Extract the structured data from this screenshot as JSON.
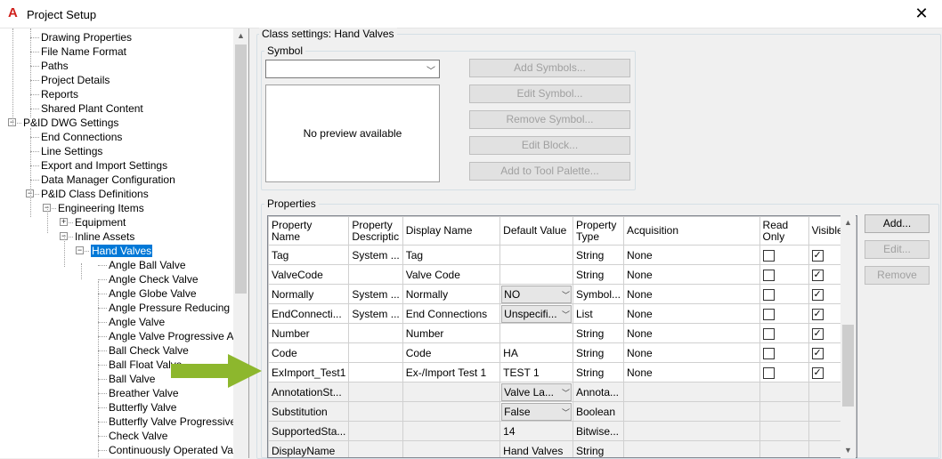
{
  "window": {
    "title": "Project Setup",
    "app_icon": "A",
    "close_glyph": "✕"
  },
  "tree": {
    "items": [
      "Drawing Properties",
      "File Name Format",
      "Paths",
      "Project Details",
      "Reports",
      "Shared Plant Content",
      "P&ID DWG Settings",
      "End Connections",
      "Line Settings",
      "Export and Import Settings",
      "Data Manager Configuration",
      "P&ID Class Definitions",
      "Engineering Items",
      "Equipment",
      "Inline Assets",
      "Hand Valves",
      "Angle Ball Valve",
      "Angle Check Valve",
      "Angle Globe Valve",
      "Angle Pressure Reducing Inje",
      "Angle Valve",
      "Angle Valve Progressive Adju",
      "Ball Check Valve",
      "Ball Float Valve",
      "Ball Valve",
      "Breather Valve",
      "Butterfly Valve",
      "Butterfly Valve Progressive Ad",
      "Check Valve",
      "Continuously Operated Valve"
    ]
  },
  "class_settings": {
    "title": "Class settings: Hand Valves",
    "symbol_group": "Symbol",
    "preview_text": "No preview available",
    "buttons": [
      "Add Symbols...",
      "Edit Symbol...",
      "Remove Symbol...",
      "Edit Block...",
      "Add to Tool Palette..."
    ]
  },
  "properties": {
    "group": "Properties",
    "columns": [
      "Property Name",
      "Property Description",
      "Display Name",
      "Default Value",
      "Property Type",
      "Acquisition",
      "Read Only",
      "Visible"
    ],
    "column_labels": [
      [
        "Property",
        "Name"
      ],
      [
        "Property",
        "Descriptic"
      ],
      [
        "Display Name"
      ],
      [
        "Default Value"
      ],
      [
        "Property",
        "Type"
      ],
      [
        "Acquisition"
      ],
      [
        "Read",
        "Only"
      ],
      [
        "Visible"
      ]
    ],
    "rows": [
      {
        "name": "Tag",
        "desc": "System ...",
        "display": "Tag",
        "default": "",
        "type": "String",
        "acq": "None",
        "ro": false,
        "vis": true,
        "combo": false
      },
      {
        "name": "ValveCode",
        "desc": "",
        "display": "Valve Code",
        "default": "",
        "type": "String",
        "acq": "None",
        "ro": false,
        "vis": true,
        "combo": false
      },
      {
        "name": "Normally",
        "desc": "System ...",
        "display": "Normally",
        "default": "NO",
        "type": "Symbol...",
        "acq": "None",
        "ro": false,
        "vis": true,
        "combo": true
      },
      {
        "name": "EndConnecti...",
        "desc": "System ...",
        "display": "End Connections",
        "default": "Unspecifi...",
        "type": "List",
        "acq": "None",
        "ro": false,
        "vis": true,
        "combo": true
      },
      {
        "name": "Number",
        "desc": "",
        "display": "Number",
        "default": "",
        "type": "String",
        "acq": "None",
        "ro": false,
        "vis": true,
        "combo": false
      },
      {
        "name": "Code",
        "desc": "",
        "display": "Code",
        "default": "HA",
        "type": "String",
        "acq": "None",
        "ro": false,
        "vis": true,
        "combo": false
      },
      {
        "name": "ExImport_Test1",
        "desc": "",
        "display": "Ex-/Import Test 1",
        "default": "TEST 1",
        "type": "String",
        "acq": "None",
        "ro": false,
        "vis": true,
        "combo": false
      },
      {
        "name": "AnnotationSt...",
        "desc": "",
        "display": "",
        "default": "Valve La...",
        "type": "Annota...",
        "acq": "",
        "ro": null,
        "vis": null,
        "combo": true
      },
      {
        "name": "Substitution",
        "desc": "",
        "display": "",
        "default": "False",
        "type": "Boolean",
        "acq": "",
        "ro": null,
        "vis": null,
        "combo": true
      },
      {
        "name": "SupportedSta...",
        "desc": "",
        "display": "",
        "default": "14",
        "type": "Bitwise...",
        "acq": "",
        "ro": null,
        "vis": null,
        "combo": false
      },
      {
        "name": "DisplayName",
        "desc": "",
        "display": "",
        "default": "Hand Valves",
        "type": "String",
        "acq": "",
        "ro": null,
        "vis": null,
        "combo": false
      }
    ],
    "buttons": {
      "add": "Add...",
      "edit": "Edit...",
      "remove": "Remove"
    }
  },
  "colors": {
    "selection": "#0078d7",
    "arrow": "#8db72d",
    "autocad_red": "#d0211c"
  }
}
